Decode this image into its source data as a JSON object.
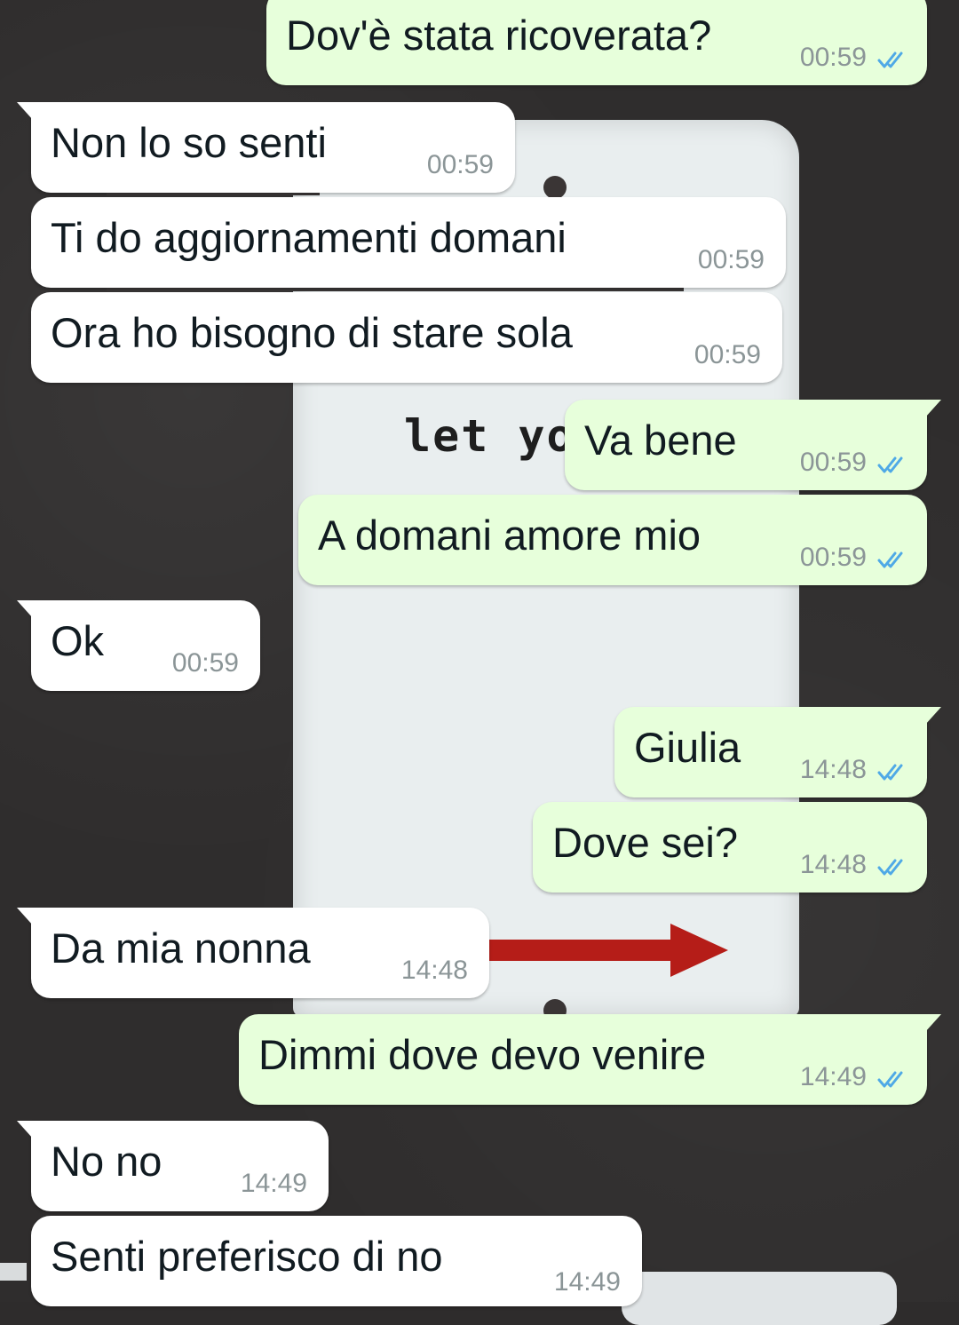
{
  "chat": {
    "read_receipt_color": "#4fa9e6",
    "messages": [
      {
        "direction": "out",
        "text": "Dov'è stata ricoverata?",
        "time": "00:59",
        "status": "read"
      },
      {
        "direction": "in",
        "text": "Non lo so senti",
        "time": "00:59"
      },
      {
        "direction": "in",
        "text": "Ti do aggiornamenti domani",
        "time": "00:59"
      },
      {
        "direction": "in",
        "text": "Ora ho bisogno di stare sola",
        "time": "00:59"
      },
      {
        "direction": "out",
        "text": "Va bene",
        "time": "00:59",
        "status": "read"
      },
      {
        "direction": "out",
        "text": "A domani amore mio",
        "time": "00:59",
        "status": "read"
      },
      {
        "direction": "in",
        "text": "Ok",
        "time": "00:59"
      },
      {
        "direction": "out",
        "text": "Giulia",
        "time": "14:48",
        "status": "read"
      },
      {
        "direction": "out",
        "text": "Dove sei?",
        "time": "14:48",
        "status": "read"
      },
      {
        "direction": "in",
        "text": "Da mia nonna",
        "time": "14:48"
      },
      {
        "direction": "out",
        "text": "Dimmi dove devo venire",
        "time": "14:49",
        "status": "read"
      },
      {
        "direction": "in",
        "text": "No no",
        "time": "14:49"
      },
      {
        "direction": "in",
        "text": "Senti preferisco di no",
        "time": "14:49"
      }
    ]
  },
  "wallpaper": {
    "sign_text": "let yo"
  }
}
